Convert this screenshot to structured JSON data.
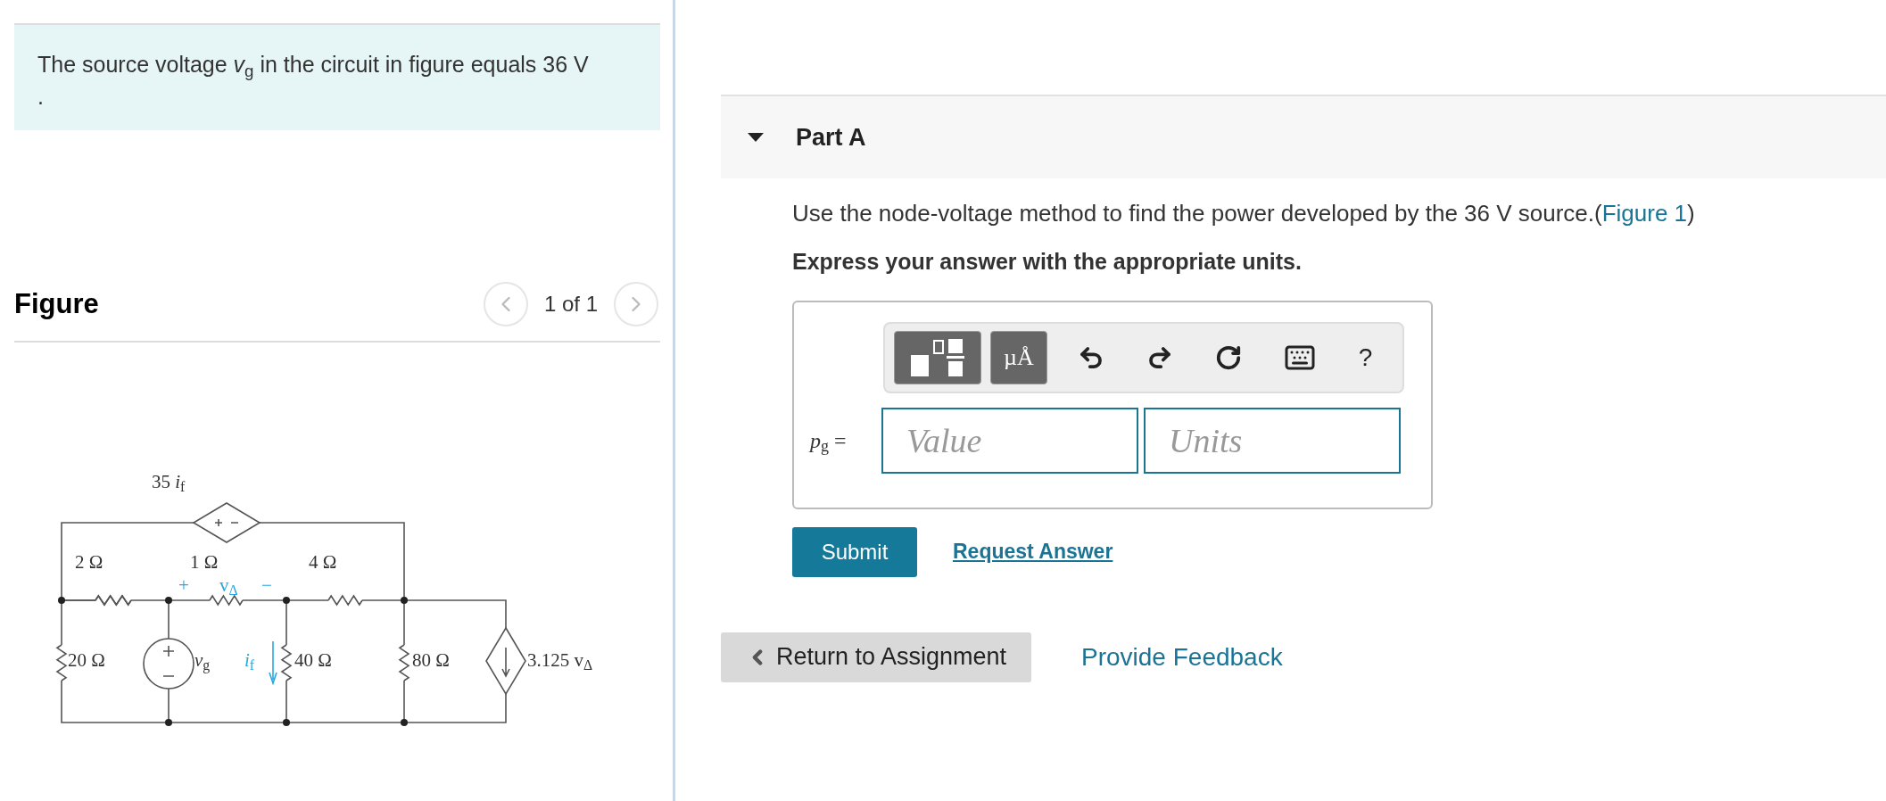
{
  "intro": {
    "lines": [
      "The source voltage *v*$_{g}$ in the circuit in figure equals 36 V",
      "."
    ]
  },
  "figure": {
    "title": "Figure",
    "pager": "1 of 1",
    "circuit_labels": [
      {
        "text": "35 *i*$_{f}$",
        "kind": "plain"
      },
      {
        "text": "2 Ω",
        "kind": "plain"
      },
      {
        "text": "1 Ω",
        "kind": "plain"
      },
      {
        "text": "4 Ω",
        "kind": "plain"
      },
      {
        "text": "+",
        "kind": "blue"
      },
      {
        "text": "v$_{Δ}$",
        "kind": "blue"
      },
      {
        "text": "−",
        "kind": "blue"
      },
      {
        "text": "20 Ω",
        "kind": "plain"
      },
      {
        "text": "*v*$_{g}$",
        "kind": "plain"
      },
      {
        "text": "*i*$_{f}$",
        "kind": "blue"
      },
      {
        "text": "40 Ω",
        "kind": "plain"
      },
      {
        "text": "80 Ω",
        "kind": "plain"
      },
      {
        "text": "3.125 v$_{Δ}$",
        "kind": "plain"
      }
    ]
  },
  "part": {
    "title": "Part A",
    "expanded": true,
    "question_before": "Use the node-voltage method to find the power developed by the 36 V source.(",
    "question_link": "Figure 1",
    "question_after": ")",
    "instruction": "Express your answer with the appropriate units.",
    "toolbar": {
      "units_button": "µÅ",
      "help": "?"
    },
    "answer_label": "*p*$_{g}$ =",
    "value_placeholder": "Value",
    "units_placeholder": "Units",
    "submit": "Submit",
    "request": "Request Answer"
  },
  "footer": {
    "return": "Return to Assignment",
    "feedback": "Provide Feedback"
  }
}
